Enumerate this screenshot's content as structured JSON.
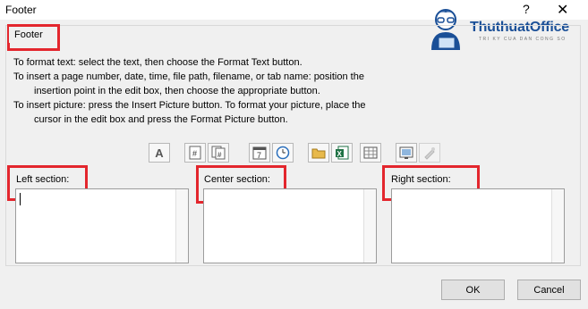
{
  "window": {
    "title": "Footer",
    "help_glyph": "?",
    "close_glyph": "✕"
  },
  "brand": {
    "name": "ThuthuatOffice",
    "tagline": "TRI KY CUA DAN CONG SO"
  },
  "group": {
    "label": "Footer"
  },
  "instructions": [
    "To format text:  select the text, then choose the Format Text button.",
    "To insert a page number, date, time, file path, filename, or tab name:  position the",
    "insertion point in the edit box, then choose the appropriate button.",
    "To insert picture: press the Insert Picture button.  To format your picture, place the",
    "cursor in the edit box and press the Format Picture button."
  ],
  "toolbar": {
    "format_text": "A",
    "page_number": "#",
    "number_of_pages": "#",
    "date": "7",
    "time": "◷",
    "file_path": "📂",
    "filename": "X",
    "sheet_name": "▦",
    "insert_picture": "🖼",
    "format_picture": "✎"
  },
  "sections": {
    "left": "Left section:",
    "center": "Center section:",
    "right": "Right section:"
  },
  "buttons": {
    "ok": "OK",
    "cancel": "Cancel"
  },
  "colors": {
    "highlight": "#e3262d",
    "brand": "#1a4f97",
    "excel_green": "#1f7244"
  }
}
